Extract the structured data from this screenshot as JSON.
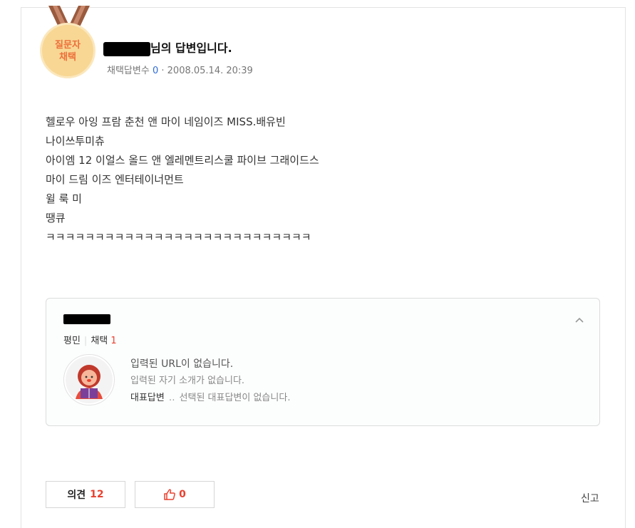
{
  "medal": {
    "label_line1": "질문자",
    "label_line2": "채택"
  },
  "answer_header": {
    "author_suffix": "님의 답변입니다.",
    "adopted_count_label": "채택답변수",
    "adopted_count": "0",
    "separator": "·",
    "timestamp": "2008.05.14. 20:39"
  },
  "answer_lines": [
    "헬로우 아잉 프람 춘천 앤 마이 네임이즈 MISS.배유빈",
    "나이쓰투미츄",
    "아이엠 12 이얼스 올드 앤 엘레멘트리스쿨 파이브 그래이드스",
    "마이 드림 이즈 엔터테이너먼트",
    "윌 룩 미",
    "땡큐",
    "ㅋㅋㅋㅋㅋㅋㅋㅋㅋㅋㅋㅋㅋㅋㅋㅋㅋㅋㅋㅋㅋㅋㅋㅋㅋㅋㅋ"
  ],
  "profile_card": {
    "grade": "평민",
    "adopt_label": "채택",
    "adopt_count": "1",
    "url_text": "입력된 URL이 없습니다.",
    "intro_text": "입력된 자기 소개가 없습니다.",
    "rep_label": "대표답변",
    "rep_dots": "‥",
    "rep_value": "선택된 대표답변이 없습니다.",
    "collapse_icon": "chevron-up-icon"
  },
  "actions": {
    "opinion_label": "의견",
    "opinion_count": "12",
    "like_count": "0",
    "report_label": "신고"
  },
  "colors": {
    "accent_red": "#e9412f",
    "link_blue": "#2f6bd6",
    "medal_orange": "#ec6f3a"
  }
}
